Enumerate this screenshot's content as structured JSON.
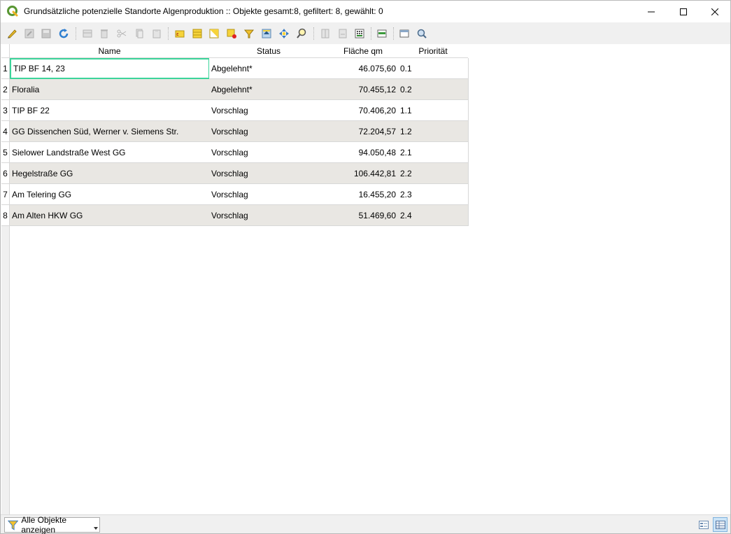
{
  "window": {
    "title": "Grundsätzliche potenzielle Standorte Algenproduktion :: Objekte gesamt:8, gefiltert: 8, gewählt: 0"
  },
  "toolbar": {
    "buttons": [
      {
        "name": "toggle-editing-icon"
      },
      {
        "name": "multi-edit-icon"
      },
      {
        "name": "save-edits-icon"
      },
      {
        "name": "reload-icon"
      },
      {
        "name": "add-feature-icon"
      },
      {
        "name": "delete-feature-icon"
      },
      {
        "name": "cut-icon"
      },
      {
        "name": "copy-icon"
      },
      {
        "name": "paste-icon"
      },
      {
        "name": "select-by-expression-icon"
      },
      {
        "name": "select-all-icon"
      },
      {
        "name": "invert-selection-icon"
      },
      {
        "name": "deselect-all-icon"
      },
      {
        "name": "filter-select-icon"
      },
      {
        "name": "move-selection-to-top-icon"
      },
      {
        "name": "pan-to-selection-icon"
      },
      {
        "name": "zoom-to-selection-icon"
      },
      {
        "name": "new-field-icon"
      },
      {
        "name": "delete-field-icon"
      },
      {
        "name": "field-calculator-icon"
      },
      {
        "name": "conditional-formatting-icon"
      },
      {
        "name": "actions-icon"
      },
      {
        "name": "dock-table-icon"
      }
    ]
  },
  "table": {
    "columns": [
      "Name",
      "Status",
      "Fläche qm",
      "Priorität"
    ],
    "rows": [
      {
        "num": "1",
        "name": "TIP BF 14, 23",
        "status": "Abgelehnt*",
        "flaeche": "46.075,60",
        "prio": "0.1"
      },
      {
        "num": "2",
        "name": "Floralia",
        "status": "Abgelehnt*",
        "flaeche": "70.455,12",
        "prio": "0.2"
      },
      {
        "num": "3",
        "name": "TIP BF 22",
        "status": "Vorschlag",
        "flaeche": "70.406,20",
        "prio": "1.1"
      },
      {
        "num": "4",
        "name": "GG Dissenchen Süd, Werner v. Siemens Str.",
        "status": "Vorschlag",
        "flaeche": "72.204,57",
        "prio": "1.2"
      },
      {
        "num": "5",
        "name": "Sielower Landstraße West GG",
        "status": "Vorschlag",
        "flaeche": "94.050,48",
        "prio": "2.1"
      },
      {
        "num": "6",
        "name": "Hegelstraße GG",
        "status": "Vorschlag",
        "flaeche": "106.442,81",
        "prio": "2.2"
      },
      {
        "num": "7",
        "name": "Am Telering GG",
        "status": "Vorschlag",
        "flaeche": "16.455,20",
        "prio": "2.3"
      },
      {
        "num": "8",
        "name": "Am Alten HKW GG",
        "status": "Vorschlag",
        "flaeche": "51.469,60",
        "prio": "2.4"
      }
    ]
  },
  "statusbar": {
    "filter_label": "Alle Objekte anzeigen"
  },
  "colors": {
    "focus_border": "#3bd49a",
    "alt_row": "#e9e7e3",
    "qgis_green": "#589632"
  }
}
